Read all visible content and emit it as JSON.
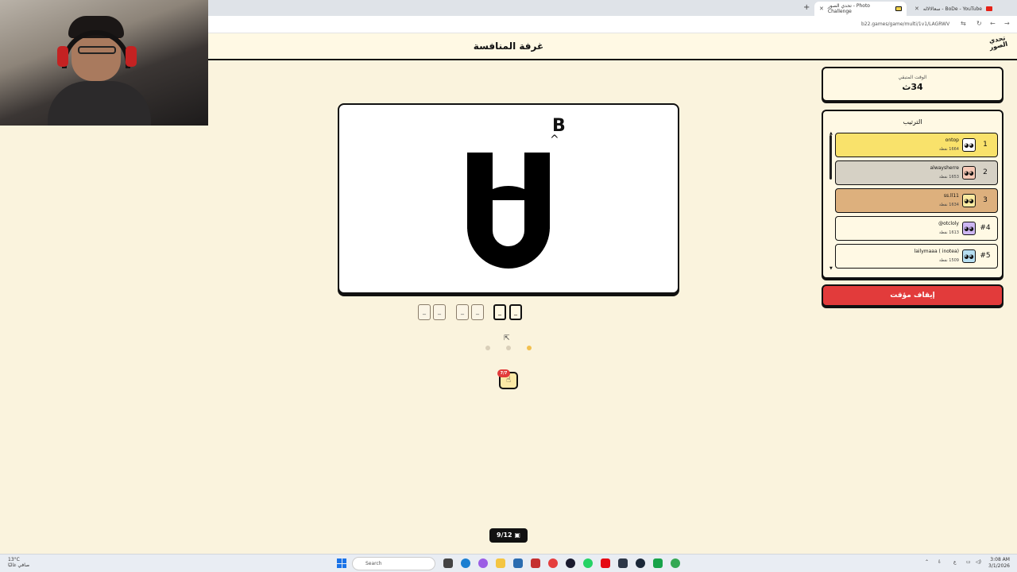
{
  "browser": {
    "tabs": [
      {
        "label": "سعالالاله - BoDe - YouTube",
        "active": false
      },
      {
        "label": "تحدي الصور - Photo Challenge",
        "active": true
      }
    ],
    "url": "b22.games/game/multi/1v1/LAGRWV"
  },
  "header": {
    "title": "غرفة المنافسة",
    "logo_text": "تحدي الصور"
  },
  "timer": {
    "label": "الوقت المتبقي",
    "value": "34ث"
  },
  "ranking": {
    "title": "الترتيب",
    "players": [
      {
        "rank": "1",
        "name": "ontop",
        "points": "1664 نقطة",
        "color": "#f9e26b"
      },
      {
        "rank": "2",
        "name": "alwaysherre",
        "points": "1653 نقطة",
        "color": "#d6d1c5"
      },
      {
        "rank": "3",
        "name": "ss.ll11",
        "points": "1634 نقطة",
        "color": "#ddb07d"
      },
      {
        "rank": "#4",
        "name": "@otcloly",
        "points": "1613 نقطة",
        "color": "#fff9e4"
      },
      {
        "rank": "#5",
        "name": "lailymaaa ( inotea)",
        "points": "1509 نقطة",
        "color": "#fff9e4"
      }
    ]
  },
  "stop_button": "إيقاف مؤقت",
  "puzzle": {
    "letter_small": "B",
    "caret": "^"
  },
  "answer_slots": [
    "_",
    "_",
    "_",
    "_",
    "_",
    "_"
  ],
  "hint": {
    "badge": "7/7",
    "icon": "hand-icon"
  },
  "progress": "9/12",
  "taskbar": {
    "weather_temp": "13°C",
    "weather_desc": "صافي غالبًا",
    "search_placeholder": "Search",
    "time": "3:08 AM",
    "date": "3/1/2026"
  },
  "colors": {
    "background": "#faf3dd",
    "accent_red": "#e23b3b",
    "gold": "#f9e26b",
    "silver": "#d6d1c5",
    "bronze": "#ddb07d"
  }
}
